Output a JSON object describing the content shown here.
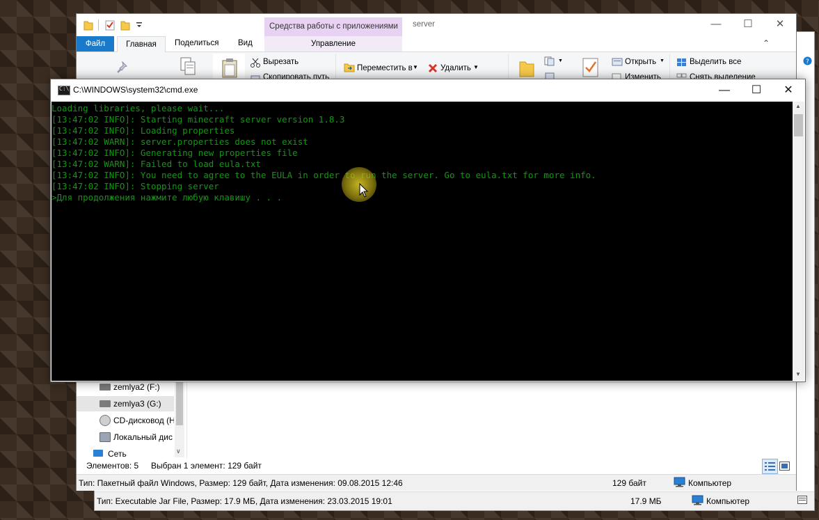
{
  "back_window": {
    "status": {
      "type_text": "Тип: Executable Jar File, Размер: 17.9 МБ, Дата изменения: 23.03.2015 19:01",
      "size": "17.9 МБ",
      "location": "Компьютер"
    }
  },
  "explorer": {
    "title": "server",
    "context_tab": "Средства работы с приложениями",
    "tabs": {
      "file": "Файл",
      "home": "Главная",
      "share": "Поделиться",
      "view": "Вид",
      "manage": "Управление"
    },
    "ribbon": {
      "cut": "Вырезать",
      "copy_path": "Скопировать путь",
      "move_to": "Переместить в",
      "delete": "Удалить",
      "open": "Открыть",
      "edit": "Изменить",
      "select_all": "Выделить все",
      "select_none": "Снять выделение"
    },
    "nav_items": [
      {
        "label": "zemlya2 (F:)",
        "icon": "drive-icon"
      },
      {
        "label": "zemlya3 (G:)",
        "icon": "drive-icon"
      },
      {
        "label": "CD-дисковод (H",
        "icon": "cd-drive-icon"
      },
      {
        "label": "Локальный дис",
        "icon": "drive-icon"
      },
      {
        "label": "Сеть",
        "icon": "network-icon"
      }
    ],
    "item_count": "Элементов: 5",
    "selection": "Выбран 1 элемент: 129 байт",
    "status": {
      "type_text": "Тип: Пакетный файл Windows, Размер: 129 байт, Дата изменения: 09.08.2015 12:46",
      "size": "129 байт",
      "location": "Компьютер"
    }
  },
  "cmd": {
    "title": "C:\\WINDOWS\\system32\\cmd.exe",
    "lines": [
      "Loading libraries, please wait...",
      "[13:47:02 INFO]: Starting minecraft server version 1.8.3",
      "[13:47:02 INFO]: Loading properties",
      "[13:47:02 WARN]: server.properties does not exist",
      "[13:47:02 INFO]: Generating new properties file",
      "[13:47:02 WARN]: Failed to load eula.txt",
      "[13:47:02 INFO]: You need to agree to the EULA in order to run the server. Go to eula.txt for more info.",
      "[13:47:02 INFO]: Stopping server",
      ">Для продолжения нажмите любую клавишу . . ."
    ],
    "text_color": "#0e9a0e"
  }
}
